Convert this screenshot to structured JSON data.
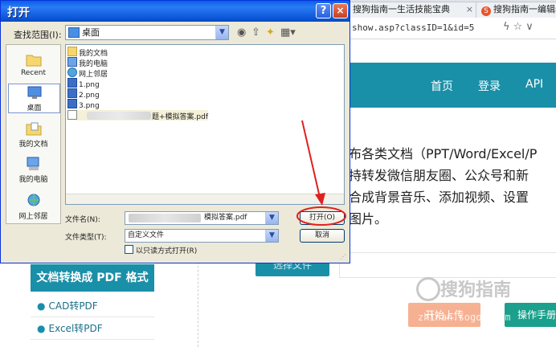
{
  "browser": {
    "tabs": [
      {
        "label": "搜狗指南一生活技能宝典",
        "close": "×"
      },
      {
        "label": "搜狗指南一编辑器",
        "favicon": "S"
      }
    ],
    "address": "show.asp?classID=1&id=5"
  },
  "site": {
    "nav": [
      "首页",
      "登录",
      "API"
    ],
    "content_lines": [
      "布各类文档（PPT/Word/Excel/P",
      "持转发微信朋友圈、公众号和新",
      "合成背景音乐、添加视频、设置",
      "图片。"
    ],
    "select_button": "选择文件",
    "sidebar_title": "文档转换成 PDF 格式",
    "sidebar_links": [
      "CAD转PDF",
      "Excel转PDF"
    ],
    "upload_button": "开始上传",
    "help_button": "操作手册",
    "watermark": "搜狗指南",
    "watermark_sub": "zhinan.sogou.com"
  },
  "dialog": {
    "title": "打开",
    "help_button": "?",
    "close_button": "×",
    "lookin_label": "查找范围(I):",
    "lookin_value": "桌面",
    "places": [
      "Recent",
      "桌面",
      "我的文档",
      "我的电脑",
      "网上邻居"
    ],
    "files": [
      {
        "name": "我的文档",
        "icon": "folder-docs"
      },
      {
        "name": "我的电脑",
        "icon": "computer"
      },
      {
        "name": "网上邻居",
        "icon": "network"
      },
      {
        "name": "1.png",
        "icon": "image"
      },
      {
        "name": "2.png",
        "icon": "image"
      },
      {
        "name": "3.png",
        "icon": "image"
      },
      {
        "name": "题+模拟答案.pdf",
        "icon": "pdf"
      }
    ],
    "filename_label": "文件名(N):",
    "filename_value": "模拟答案.pdf",
    "filetype_label": "文件类型(T):",
    "filetype_value": "自定义文件",
    "open_button": "打开(O)",
    "cancel_button": "取消",
    "readonly_label": "以只读方式打开(R)"
  },
  "colors": {
    "site_teal": "#1a8fa8",
    "xp_blue": "#0a5fe8",
    "annotation_red": "#e02020"
  }
}
